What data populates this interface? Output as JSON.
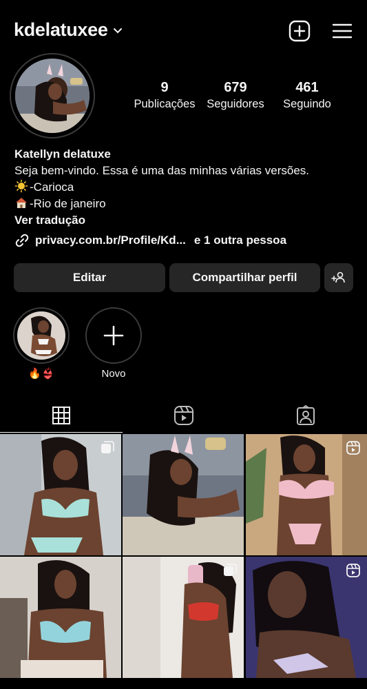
{
  "header": {
    "username": "kdelatuxee",
    "icons": [
      "chevron-down-icon",
      "new-post-icon",
      "menu-icon"
    ]
  },
  "stats": {
    "posts": {
      "value": "9",
      "label": "Publicações"
    },
    "followers": {
      "value": "679",
      "label": "Seguidores"
    },
    "following": {
      "value": "461",
      "label": "Seguindo"
    }
  },
  "bio": {
    "name": "Katellyn delatuxe",
    "line1": "Seja bem-vindo. Essa é uma das minhas várias versões.",
    "line2": "-Carioca",
    "line3": "-Rio de janeiro",
    "translate": "Ver tradução"
  },
  "link": {
    "url": "privacy.com.br/Profile/Kd...",
    "others": "e 1 outra pessoa"
  },
  "buttons": {
    "edit": "Editar",
    "share": "Compartilhar perfil"
  },
  "highlights": [
    {
      "caption": "🔥👙"
    },
    {
      "caption": "Novo"
    }
  ],
  "tabs": [
    "grid-icon",
    "reels-icon",
    "tagged-icon"
  ],
  "grid": {
    "badges": [
      "carousel",
      "none",
      "reel",
      "none",
      "carousel",
      "reel"
    ]
  },
  "colors": {
    "background": "#000000",
    "button": "#262626",
    "text": "#f5f5f5"
  }
}
